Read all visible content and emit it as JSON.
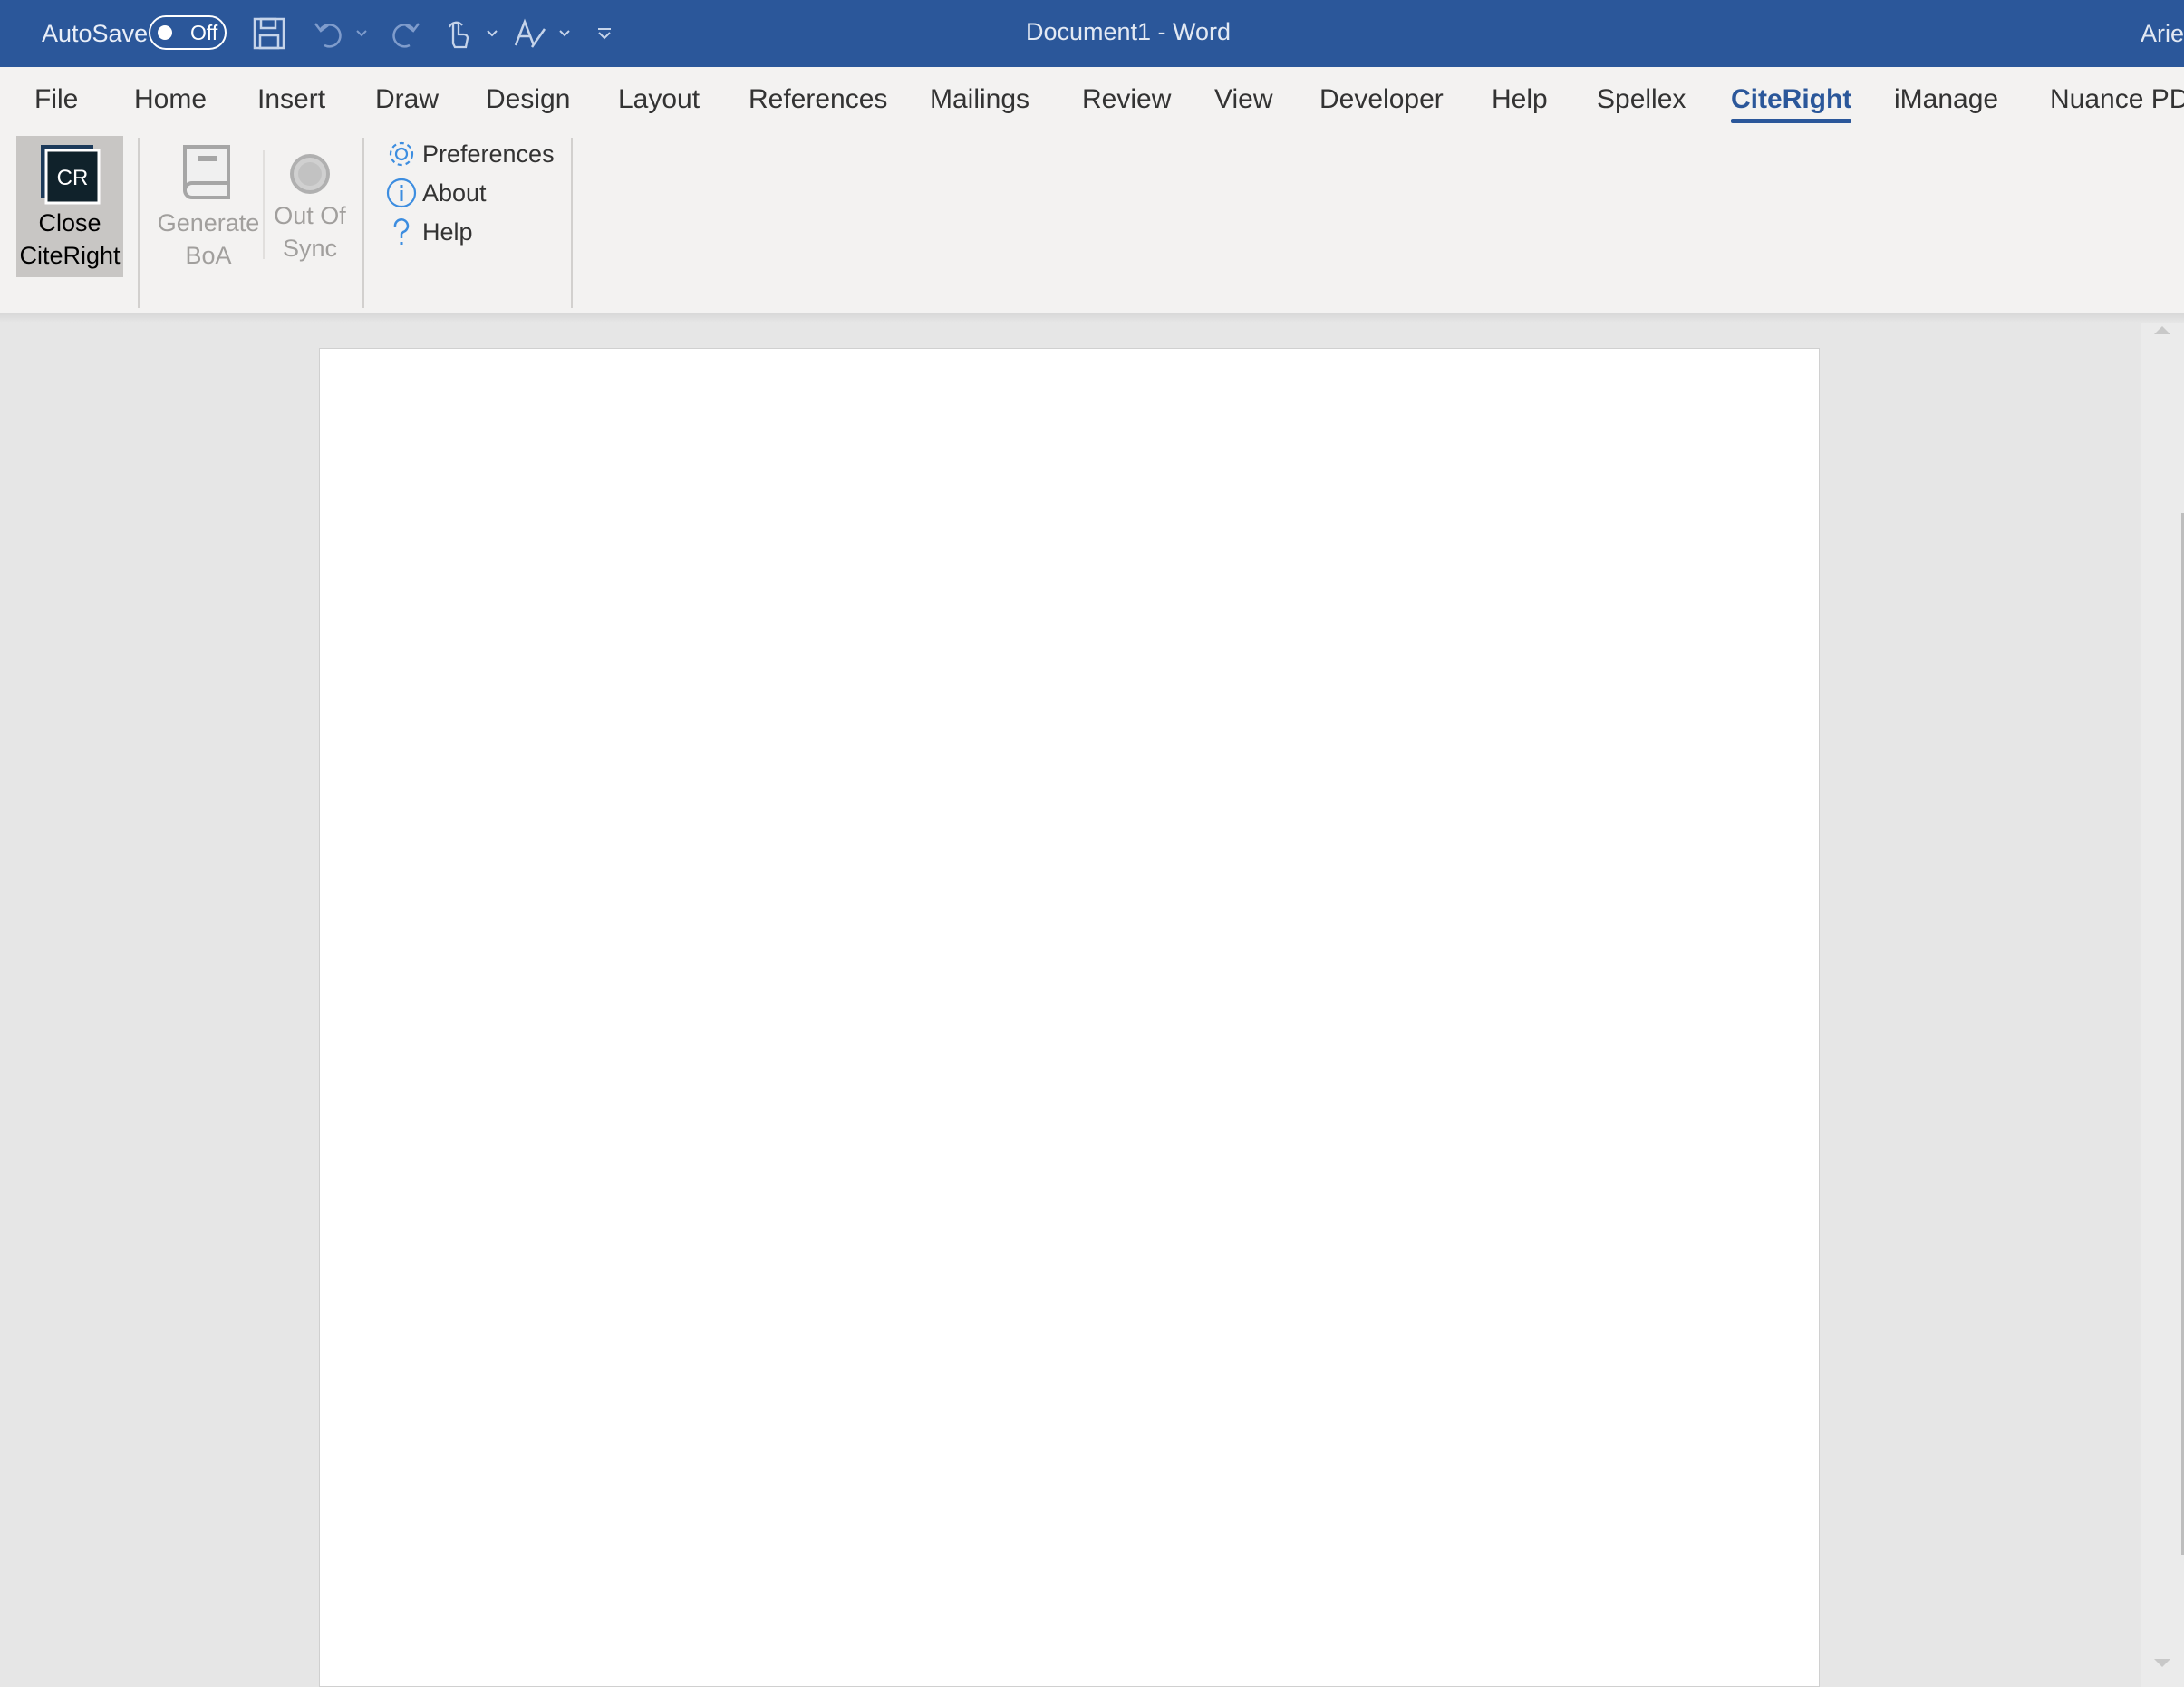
{
  "titlebar": {
    "autosave_label": "AutoSave",
    "autosave_state": "Off",
    "document_title": "Document1  -  Word",
    "user_name": "Arie",
    "background_color": "#2b579a",
    "quick_access": [
      "save-icon",
      "undo-icon",
      "redo-icon",
      "touch-mode-icon",
      "ink-editor-icon",
      "customize-icon"
    ]
  },
  "tabs": [
    {
      "label": "File"
    },
    {
      "label": "Home"
    },
    {
      "label": "Insert"
    },
    {
      "label": "Draw"
    },
    {
      "label": "Design"
    },
    {
      "label": "Layout"
    },
    {
      "label": "References"
    },
    {
      "label": "Mailings"
    },
    {
      "label": "Review"
    },
    {
      "label": "View"
    },
    {
      "label": "Developer"
    },
    {
      "label": "Help"
    },
    {
      "label": "Spellex"
    },
    {
      "label": "CiteRight",
      "active": true
    },
    {
      "label": "iManage"
    },
    {
      "label": "Nuance PD"
    }
  ],
  "ribbon": {
    "close_citeright": {
      "line1": "Close",
      "line2": "CiteRight",
      "icon_text": "CR"
    },
    "generate_boa": {
      "line1": "Generate",
      "line2": "BoA"
    },
    "out_of_sync": {
      "line1": "Out Of",
      "line2": "Sync"
    },
    "preferences": "Preferences",
    "about": "About",
    "help": "Help"
  },
  "colors": {
    "accent": "#2b579a",
    "ribbon_bg": "#f3f2f1",
    "canvas_bg": "#e6e6e6",
    "disabled_text": "#a19f9d"
  }
}
